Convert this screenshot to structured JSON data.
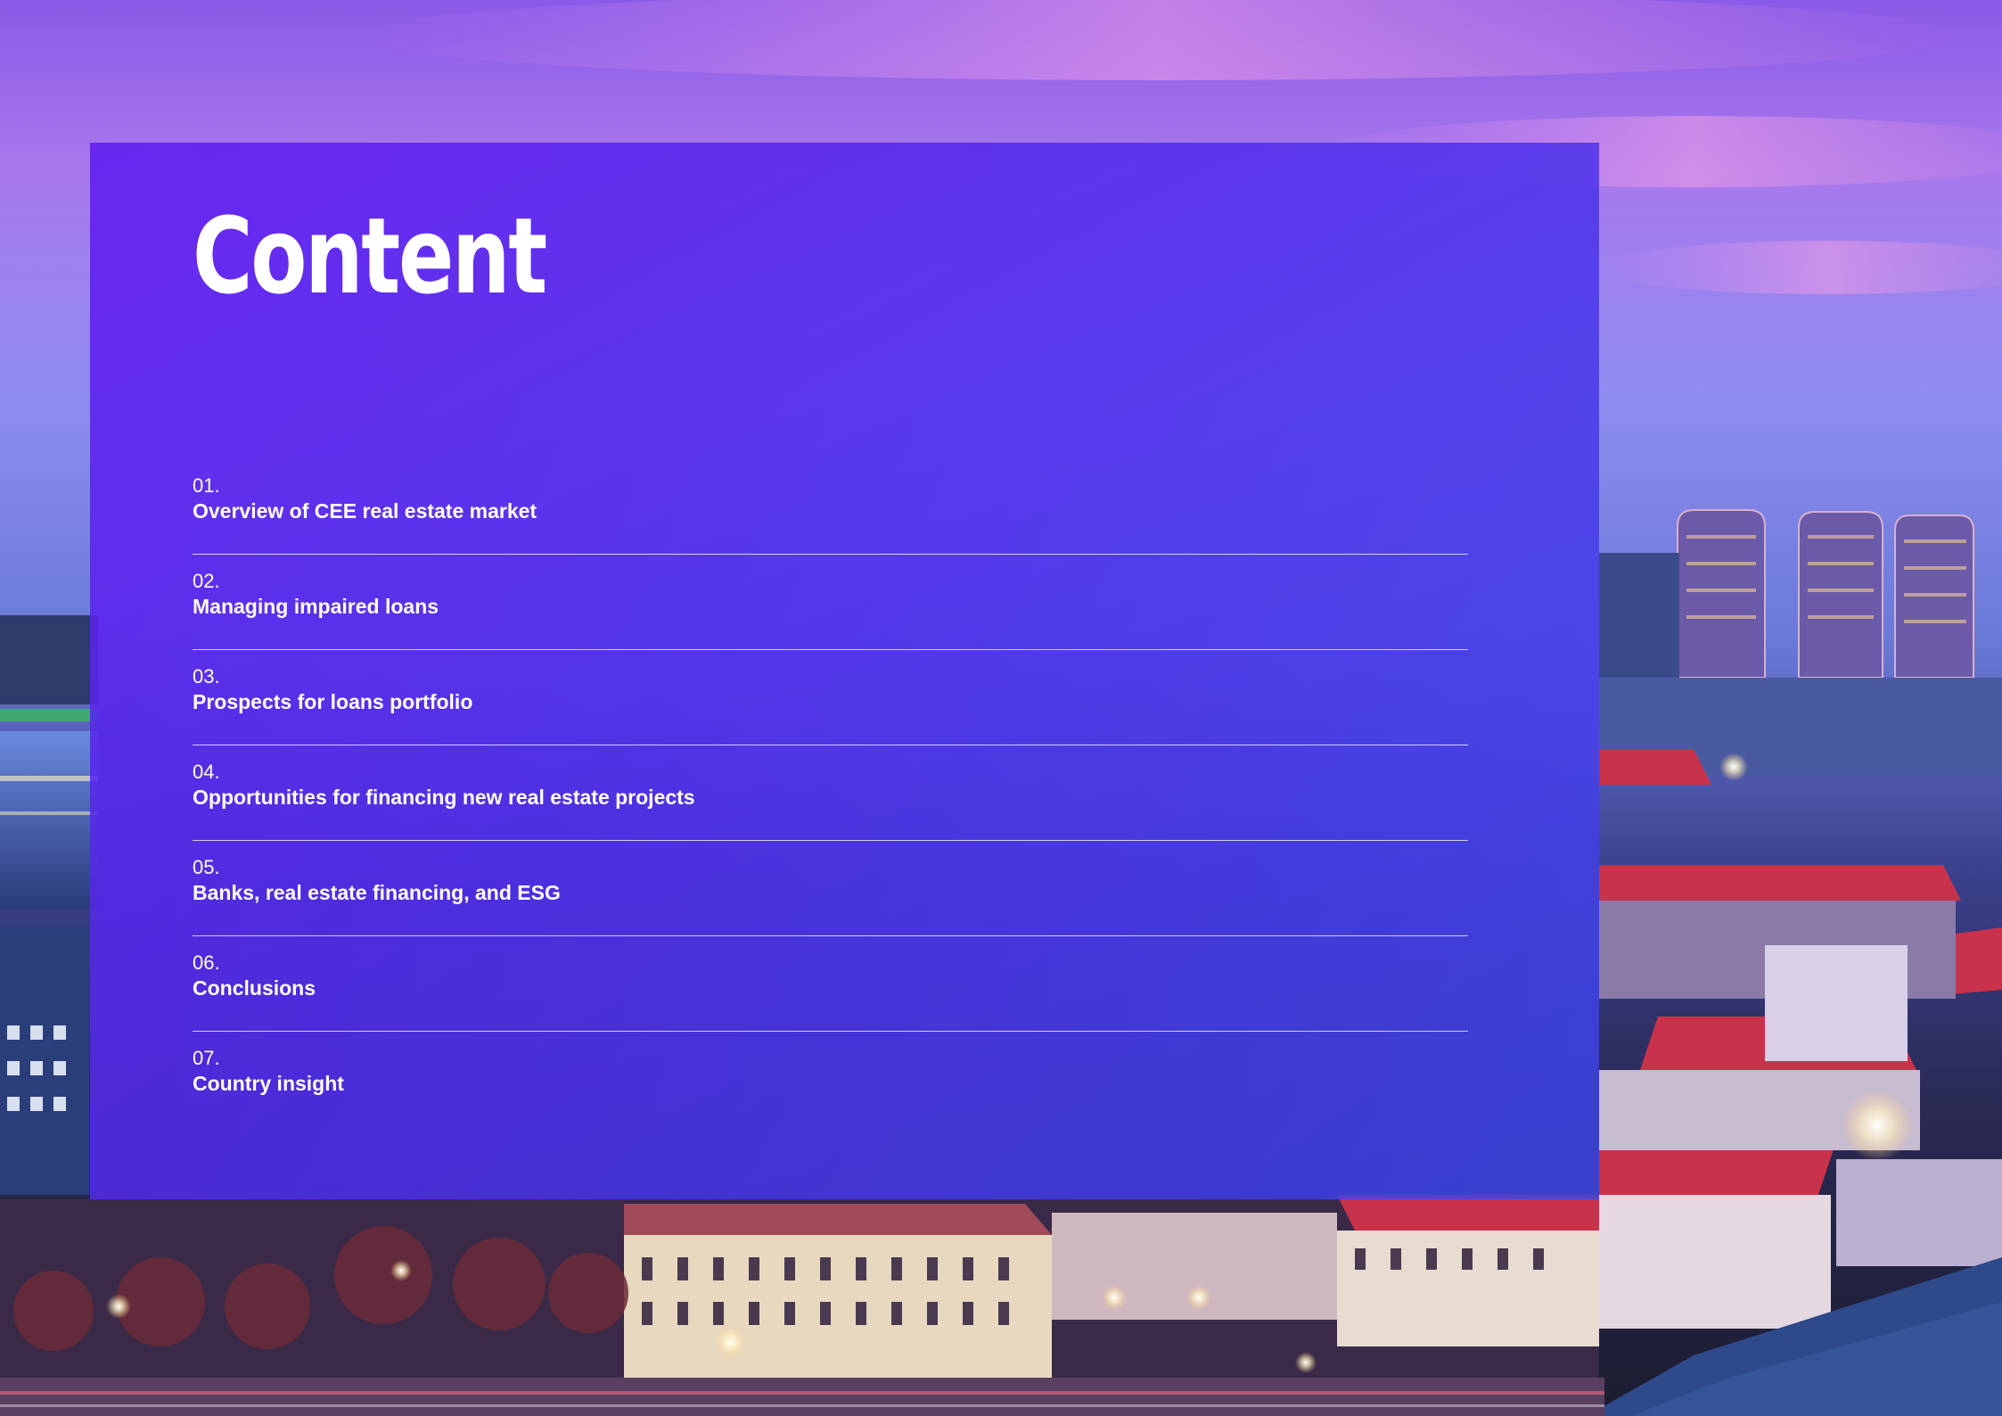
{
  "page": {
    "title": "Content"
  },
  "colors": {
    "panel": "#5a2cec",
    "text": "#ffffff",
    "divider": "#ffffff"
  },
  "toc": [
    {
      "number": "01.",
      "label": "Overview of CEE real estate market"
    },
    {
      "number": "02.",
      "label": "Managing impaired loans"
    },
    {
      "number": "03.",
      "label": "Prospects for loans portfolio"
    },
    {
      "number": "04.",
      "label": "Opportunities for financing new real estate projects"
    },
    {
      "number": "05.",
      "label": "Banks, real estate financing, and ESG"
    },
    {
      "number": "06.",
      "label": "Conclusions"
    },
    {
      "number": "07.",
      "label": "Country insight"
    }
  ]
}
